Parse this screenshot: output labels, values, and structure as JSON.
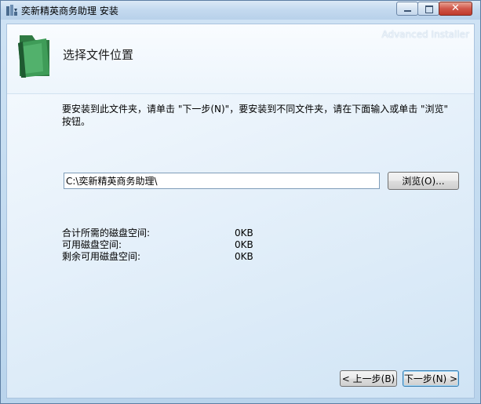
{
  "window": {
    "title": "奕新精英商务助理 安装",
    "close_glyph": "✕"
  },
  "header": {
    "title": "选择文件位置",
    "brand": "Advanced Installer"
  },
  "main": {
    "instruction": "要安装到此文件夹，请单击 \"下一步(N)\"，要安装到不同文件夹，请在下面输入或单击 \"浏览\" 按钮。",
    "path_value": "C:\\奕新精英商务助理\\",
    "browse_label": "浏览(O)...",
    "disk": [
      {
        "label": "合计所需的磁盘空间:",
        "value": "0KB"
      },
      {
        "label": "可用磁盘空间:",
        "value": "0KB"
      },
      {
        "label": "剩余可用磁盘空间:",
        "value": "0KB"
      }
    ]
  },
  "footer": {
    "back_label": "< 上一步(B)",
    "next_label": "下一步(N) >"
  },
  "colors": {
    "accent": "#3c7fb1",
    "folder_green": "#2f8a4a"
  },
  "icons": [
    "installer-app-icon",
    "folder-icon",
    "minimize-icon",
    "maximize-icon",
    "close-icon"
  ]
}
